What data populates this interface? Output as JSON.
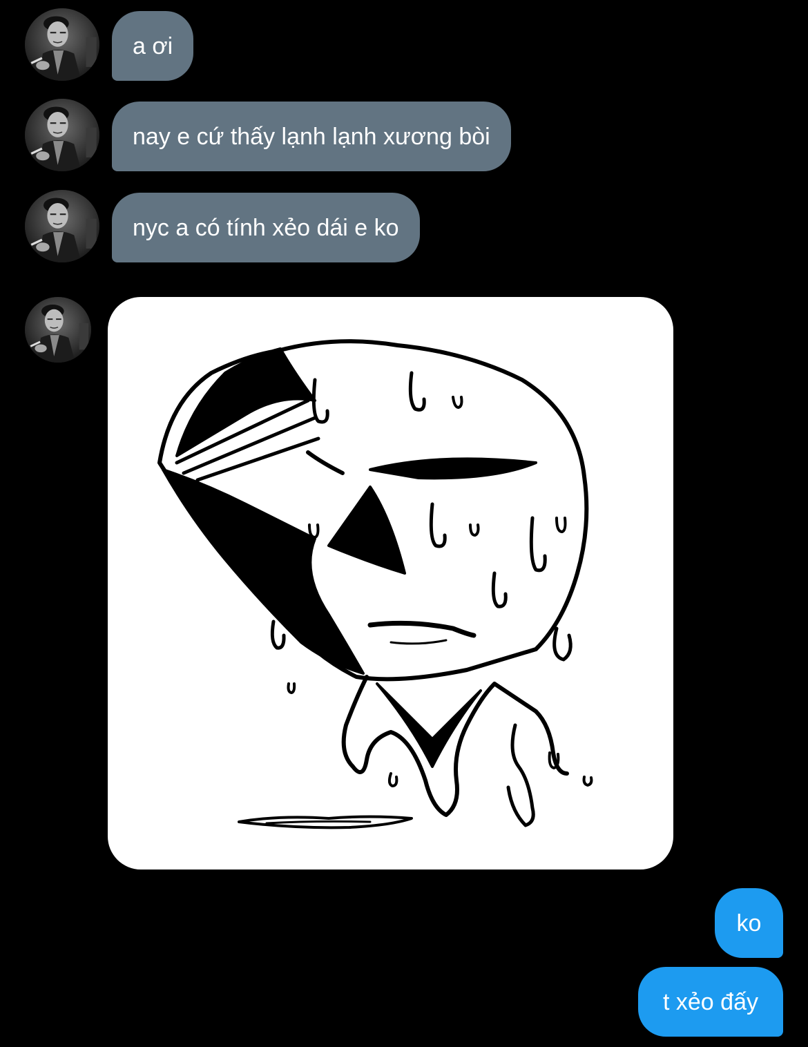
{
  "conversation": {
    "incoming": [
      {
        "text": "a ơi"
      },
      {
        "text": "nay e cứ thấy lạnh lạnh xương bòi"
      },
      {
        "text": "nyc a có tính xẻo dái e ko"
      }
    ],
    "image_message": {
      "icon": "sweating-face-sketch-icon"
    },
    "outgoing": [
      {
        "text": "ko"
      },
      {
        "text": "t xẻo đấy"
      }
    ]
  },
  "sender": {
    "avatar_icon": "profile-photo-avatar"
  },
  "colors": {
    "background": "#000000",
    "incoming_bubble": "#627482",
    "outgoing_bubble": "#1d9bf0",
    "text": "#ffffff"
  }
}
